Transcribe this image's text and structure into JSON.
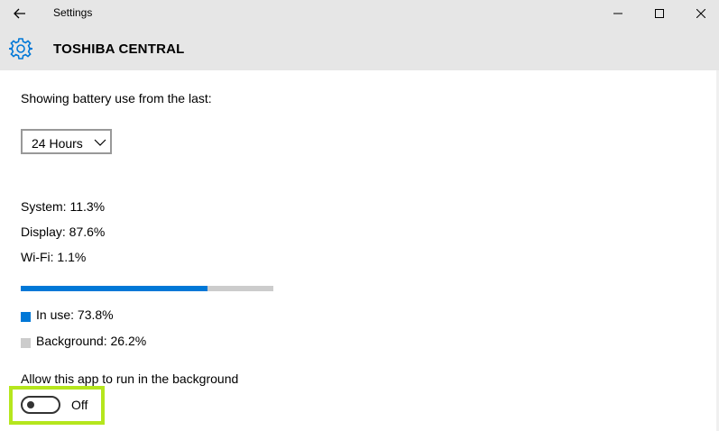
{
  "window": {
    "title": "Settings"
  },
  "header": {
    "app_title": "TOSHIBA CENTRAL"
  },
  "battery": {
    "showing_label": "Showing battery use from the last:",
    "period_selected": "24 Hours",
    "breakdown": [
      {
        "label": "System: 11.3%"
      },
      {
        "label": "Display: 87.6%"
      },
      {
        "label": "Wi-Fi: 1.1%"
      }
    ],
    "in_use_fraction": 0.738,
    "legend": {
      "in_use": "In use: 73.8%",
      "background": "Background: 26.2%"
    }
  },
  "background_setting": {
    "label": "Allow this app to run in the background",
    "toggle_state": "Off"
  },
  "colors": {
    "accent": "#0078d7",
    "track": "#cccccc",
    "highlight": "#b5e61d",
    "chrome": "#e6e6e6"
  },
  "icons": [
    "back-arrow-icon",
    "minimize-icon",
    "maximize-icon",
    "close-icon",
    "gear-icon",
    "chevron-down-icon"
  ]
}
